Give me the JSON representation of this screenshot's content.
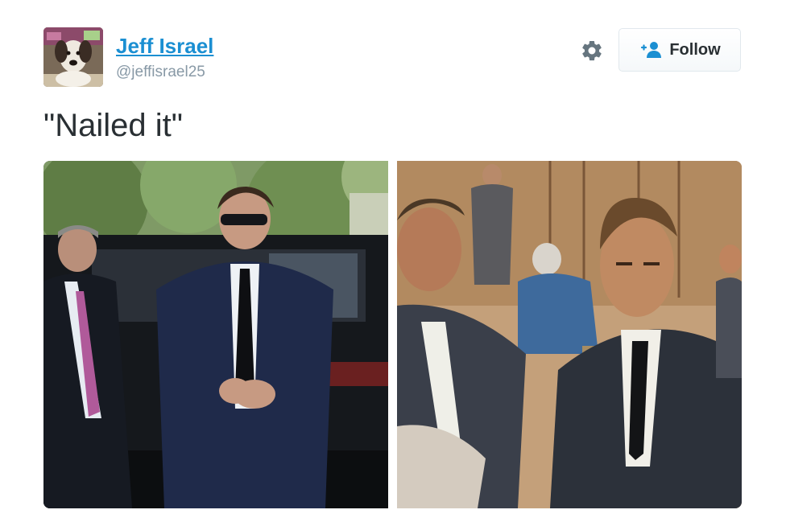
{
  "author": {
    "name": "Jeff Israel",
    "handle": "@jeffisrael25"
  },
  "actions": {
    "settings_icon": "gear-icon",
    "follow_icon": "add-user-icon",
    "follow_label": "Follow"
  },
  "tweet": {
    "text": "\"Nailed it\""
  },
  "media": [
    {
      "kind": "photo",
      "subject": "photo"
    },
    {
      "kind": "illustration",
      "subject": "courtroom sketch"
    }
  ],
  "colors": {
    "link_blue": "#1b8fd2",
    "handle_gray": "#8899a6",
    "text_dark": "#292f33"
  }
}
